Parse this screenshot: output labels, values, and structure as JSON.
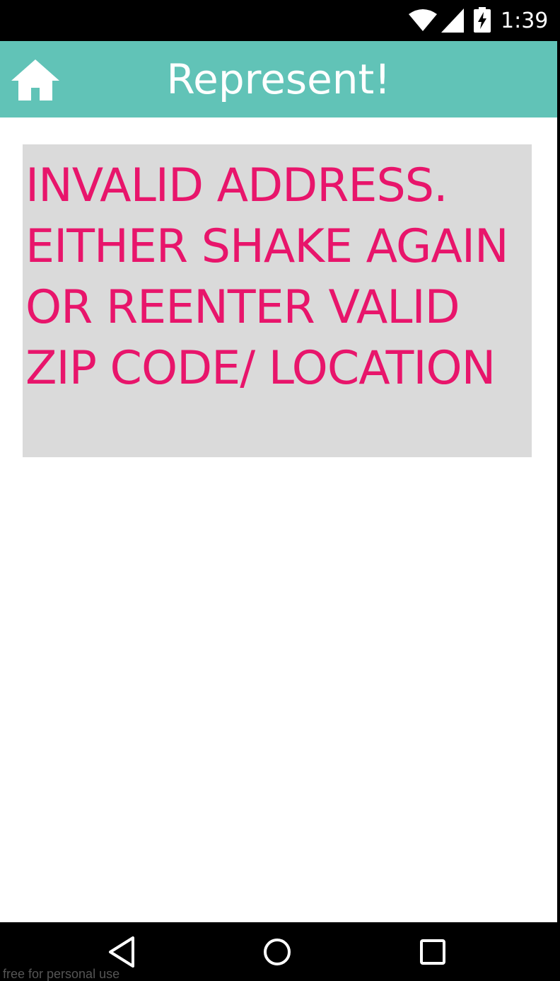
{
  "status_bar": {
    "time": "1:39",
    "icons": [
      "wifi-icon",
      "signal-icon",
      "battery-charging-icon"
    ]
  },
  "app_bar": {
    "title": "Represent!",
    "home_icon": "home-icon",
    "background_color": "#61c3b7",
    "title_color": "#ffffff"
  },
  "main": {
    "error_message": "INVALID ADDRESS. EITHER SHAKE AGAIN OR REENTER VALID ZIP CODE/ LOCATION",
    "error_text_color": "#e8156b",
    "error_box_color": "#dadada"
  },
  "nav_bar": {
    "icons": [
      "back-icon",
      "home-circle-icon",
      "recents-icon"
    ]
  },
  "watermark": "free for personal use"
}
